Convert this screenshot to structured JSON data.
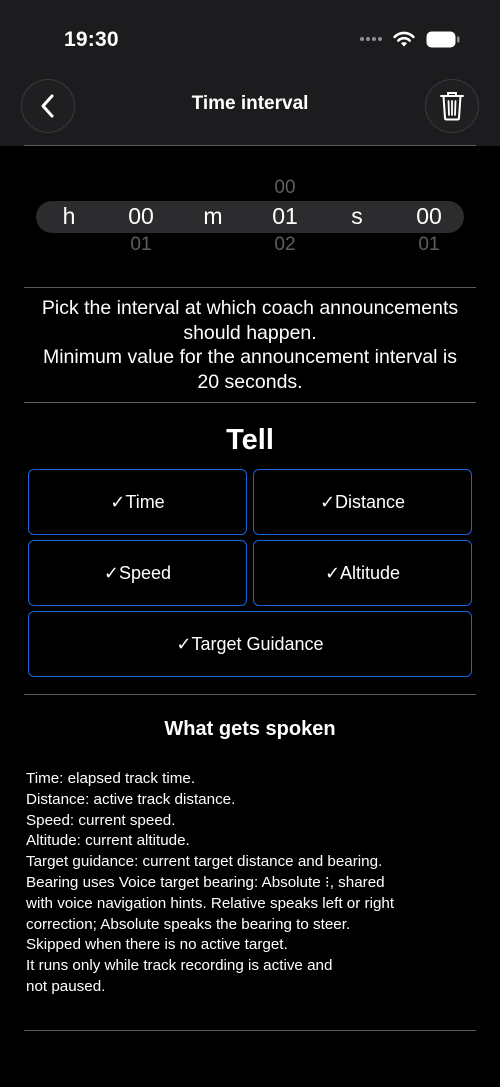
{
  "status_bar": {
    "time": "19:30"
  },
  "nav": {
    "title": "Time interval"
  },
  "picker": {
    "hours_label": "h",
    "minutes_label": "m",
    "seconds_label": "s",
    "hours_selected": "00",
    "hours_next": "01",
    "minutes_prev": "00",
    "minutes_selected": "01",
    "minutes_next": "02",
    "seconds_selected": "00",
    "seconds_next": "01"
  },
  "info": {
    "line1": "Pick the interval at which coach announcements",
    "line2": "should happen.",
    "line3": "Minimum value for the announcement interval is",
    "line4": "20 seconds."
  },
  "tell": {
    "title": "Tell",
    "options": [
      {
        "label": "✓Time"
      },
      {
        "label": "✓Distance"
      },
      {
        "label": "✓Speed"
      },
      {
        "label": "✓Altitude"
      },
      {
        "label": "✓Target Guidance"
      }
    ]
  },
  "spoken": {
    "title": "What gets spoken",
    "lines": [
      "Time: elapsed track time.",
      "Distance: active track distance.",
      "Speed: current speed.",
      "Altitude: current altitude.",
      "Target guidance: current target distance and bearing.",
      "Bearing uses Voice target bearing: Absolute ⁝, shared",
      "with voice navigation hints. Relative speaks left or right",
      "correction; Absolute speaks the bearing to steer.",
      "Skipped when there is no active target.",
      "It runs only while track recording is active and",
      "not paused."
    ]
  },
  "colors": {
    "background": "#000000",
    "header": "#1c1c1e",
    "option_border": "#1b62e0",
    "separator": "#5a5a5c"
  },
  "icons": {
    "back": "chevron-left-icon",
    "trash": "trash-icon",
    "wifi": "wifi-icon",
    "battery": "battery-icon",
    "signal": "signal-dots-icon"
  }
}
